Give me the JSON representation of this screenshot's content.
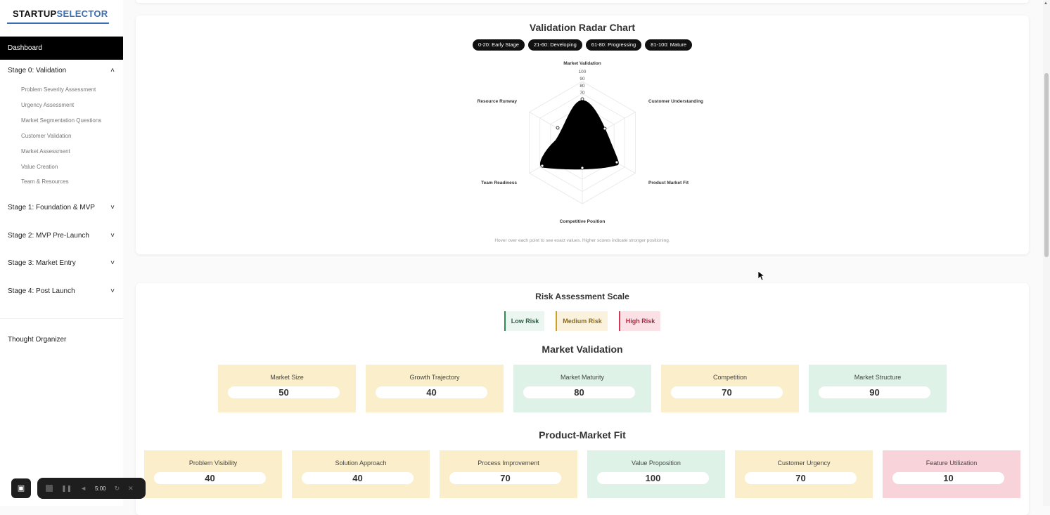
{
  "brand": {
    "part1": "STARTUP",
    "part2": "SELECTOR",
    "accent": "#3b6fb6"
  },
  "sidebar": {
    "dashboard": "Dashboard",
    "stages": [
      {
        "label": "Stage 0: Validation",
        "expanded": true
      },
      {
        "label": "Stage 1: Foundation & MVP",
        "expanded": false
      },
      {
        "label": "Stage 2: MVP Pre-Launch",
        "expanded": false
      },
      {
        "label": "Stage 3: Market Entry",
        "expanded": false
      },
      {
        "label": "Stage 4: Post Launch",
        "expanded": false
      }
    ],
    "stage0_items": [
      "Problem Severity Assessment",
      "Urgency Assessment",
      "Market Segmentation Questions",
      "Customer Validation",
      "Market Assessment",
      "Value Creation",
      "Team & Resources"
    ],
    "thought_organizer": "Thought Organizer"
  },
  "radar": {
    "title": "Validation Radar Chart",
    "legend": [
      "0-20: Early Stage",
      "21-60: Developing",
      "61-80: Progressing",
      "81-100: Mature"
    ],
    "hint": "Hover over each point to see exact values. Higher scores indicate stronger positioning."
  },
  "chart_data": {
    "type": "radar",
    "axes": [
      "Market Validation",
      "Customer Understanding",
      "Product Market Fit",
      "Competitive Position",
      "Team Readiness",
      "Resource Runway"
    ],
    "tick_labels": [
      "70",
      "80",
      "90",
      "100"
    ],
    "rlim": [
      70,
      100
    ],
    "series": [
      {
        "values": [
          70,
          80,
          83,
          70,
          83,
          80
        ],
        "color": "#000000"
      }
    ]
  },
  "risk": {
    "title": "Risk Assessment Scale",
    "low": "Low Risk",
    "medium": "Medium Risk",
    "high": "High Risk"
  },
  "market_validation": {
    "title": "Market Validation",
    "items": [
      {
        "label": "Market Size",
        "value": "50",
        "tone": "yellow"
      },
      {
        "label": "Growth Trajectory",
        "value": "40",
        "tone": "yellow"
      },
      {
        "label": "Market Maturity",
        "value": "80",
        "tone": "green"
      },
      {
        "label": "Competition",
        "value": "70",
        "tone": "yellow"
      },
      {
        "label": "Market Structure",
        "value": "90",
        "tone": "green"
      }
    ]
  },
  "pmf": {
    "title": "Product-Market Fit",
    "items": [
      {
        "label": "Problem Visibility",
        "value": "40",
        "tone": "yellow"
      },
      {
        "label": "Solution Approach",
        "value": "40",
        "tone": "yellow"
      },
      {
        "label": "Process Improvement",
        "value": "70",
        "tone": "yellow"
      },
      {
        "label": "Value Proposition",
        "value": "100",
        "tone": "green"
      },
      {
        "label": "Customer Urgency",
        "value": "70",
        "tone": "yellow"
      },
      {
        "label": "Feature Utilization",
        "value": "10",
        "tone": "pink"
      }
    ]
  },
  "recorder": {
    "time": "5:00"
  }
}
